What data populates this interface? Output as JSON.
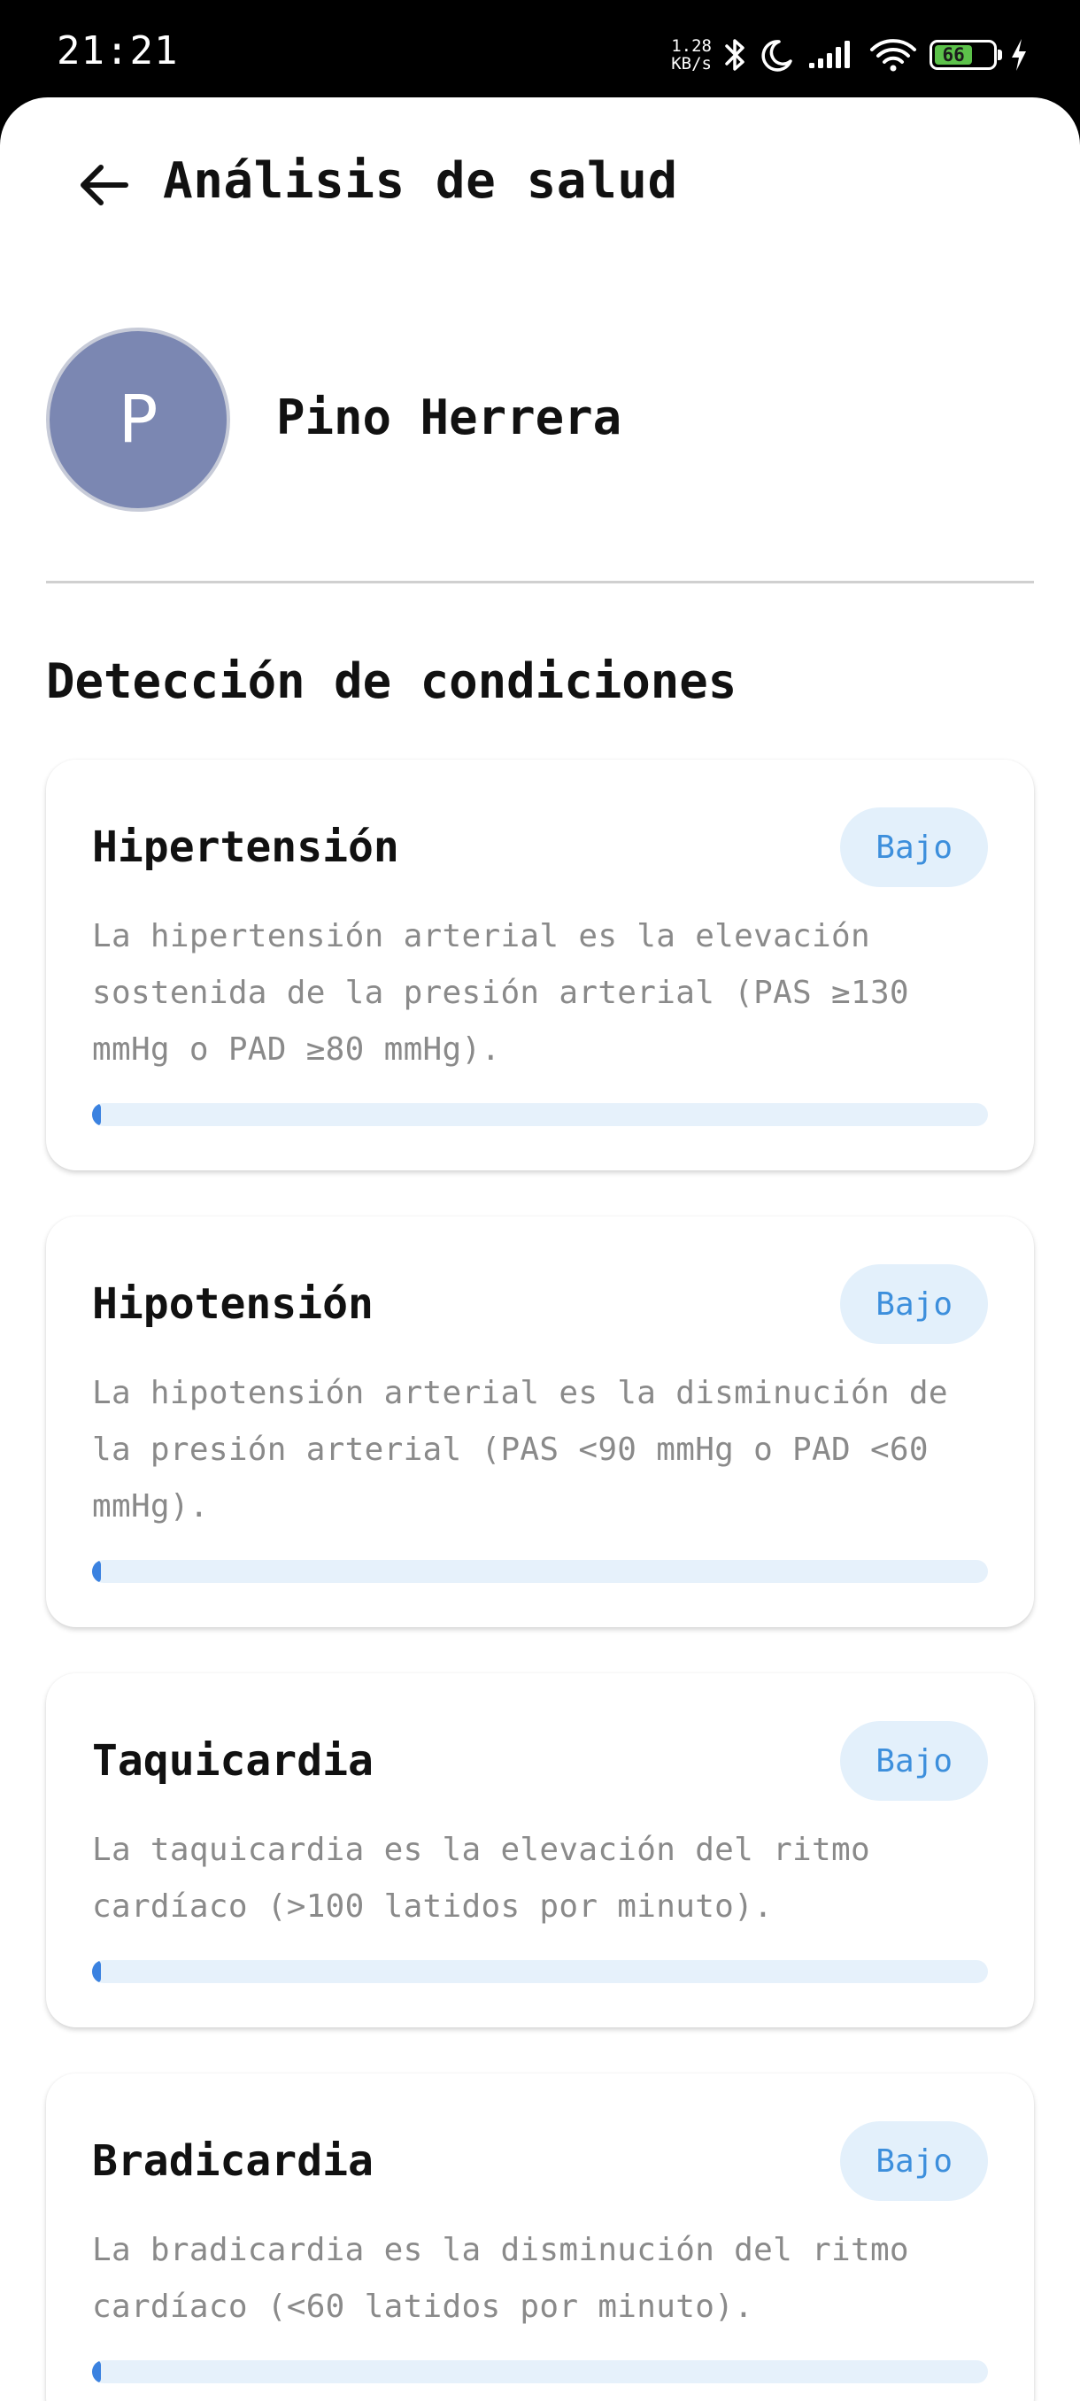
{
  "status_bar": {
    "time": "21:21",
    "net_speed_value": "1.28",
    "net_speed_unit": "KB/s",
    "battery_level": "66",
    "icons": [
      "bluetooth-icon",
      "moon-icon",
      "signal-icon",
      "wifi-icon",
      "battery-icon",
      "charging-icon"
    ]
  },
  "header": {
    "title": "Análisis de salud",
    "back_icon": "arrow-left-icon"
  },
  "profile": {
    "initial": "P",
    "name": "Pino Herrera"
  },
  "section": {
    "title": "Detección de condiciones"
  },
  "colors": {
    "badge_text": "#3d8fdc",
    "badge_bg": "#e3f0fb",
    "progress_fill": "#3b82e0",
    "progress_track": "#e6f1fb",
    "avatar_bg": "#7b87b2"
  },
  "conditions": [
    {
      "title": "Hipertensión",
      "risk": "Bajo",
      "description": "La hipertensión arterial es la elevación sostenida de la presión arterial (PAS ≥130 mmHg o PAD ≥80 mmHg).",
      "level": 0.01
    },
    {
      "title": "Hipotensión",
      "risk": "Bajo",
      "description": "La hipotensión arterial es la disminución de la presión arterial (PAS <90 mmHg o PAD <60 mmHg).",
      "level": 0.01
    },
    {
      "title": "Taquicardia",
      "risk": "Bajo",
      "description": "La taquicardia es la elevación del ritmo cardíaco (>100 latidos por minuto).",
      "level": 0.01
    },
    {
      "title": "Bradicardia",
      "risk": "Bajo",
      "description": "La bradicardia es la disminución del ritmo cardíaco (<60 latidos por minuto).",
      "level": 0.01
    }
  ]
}
